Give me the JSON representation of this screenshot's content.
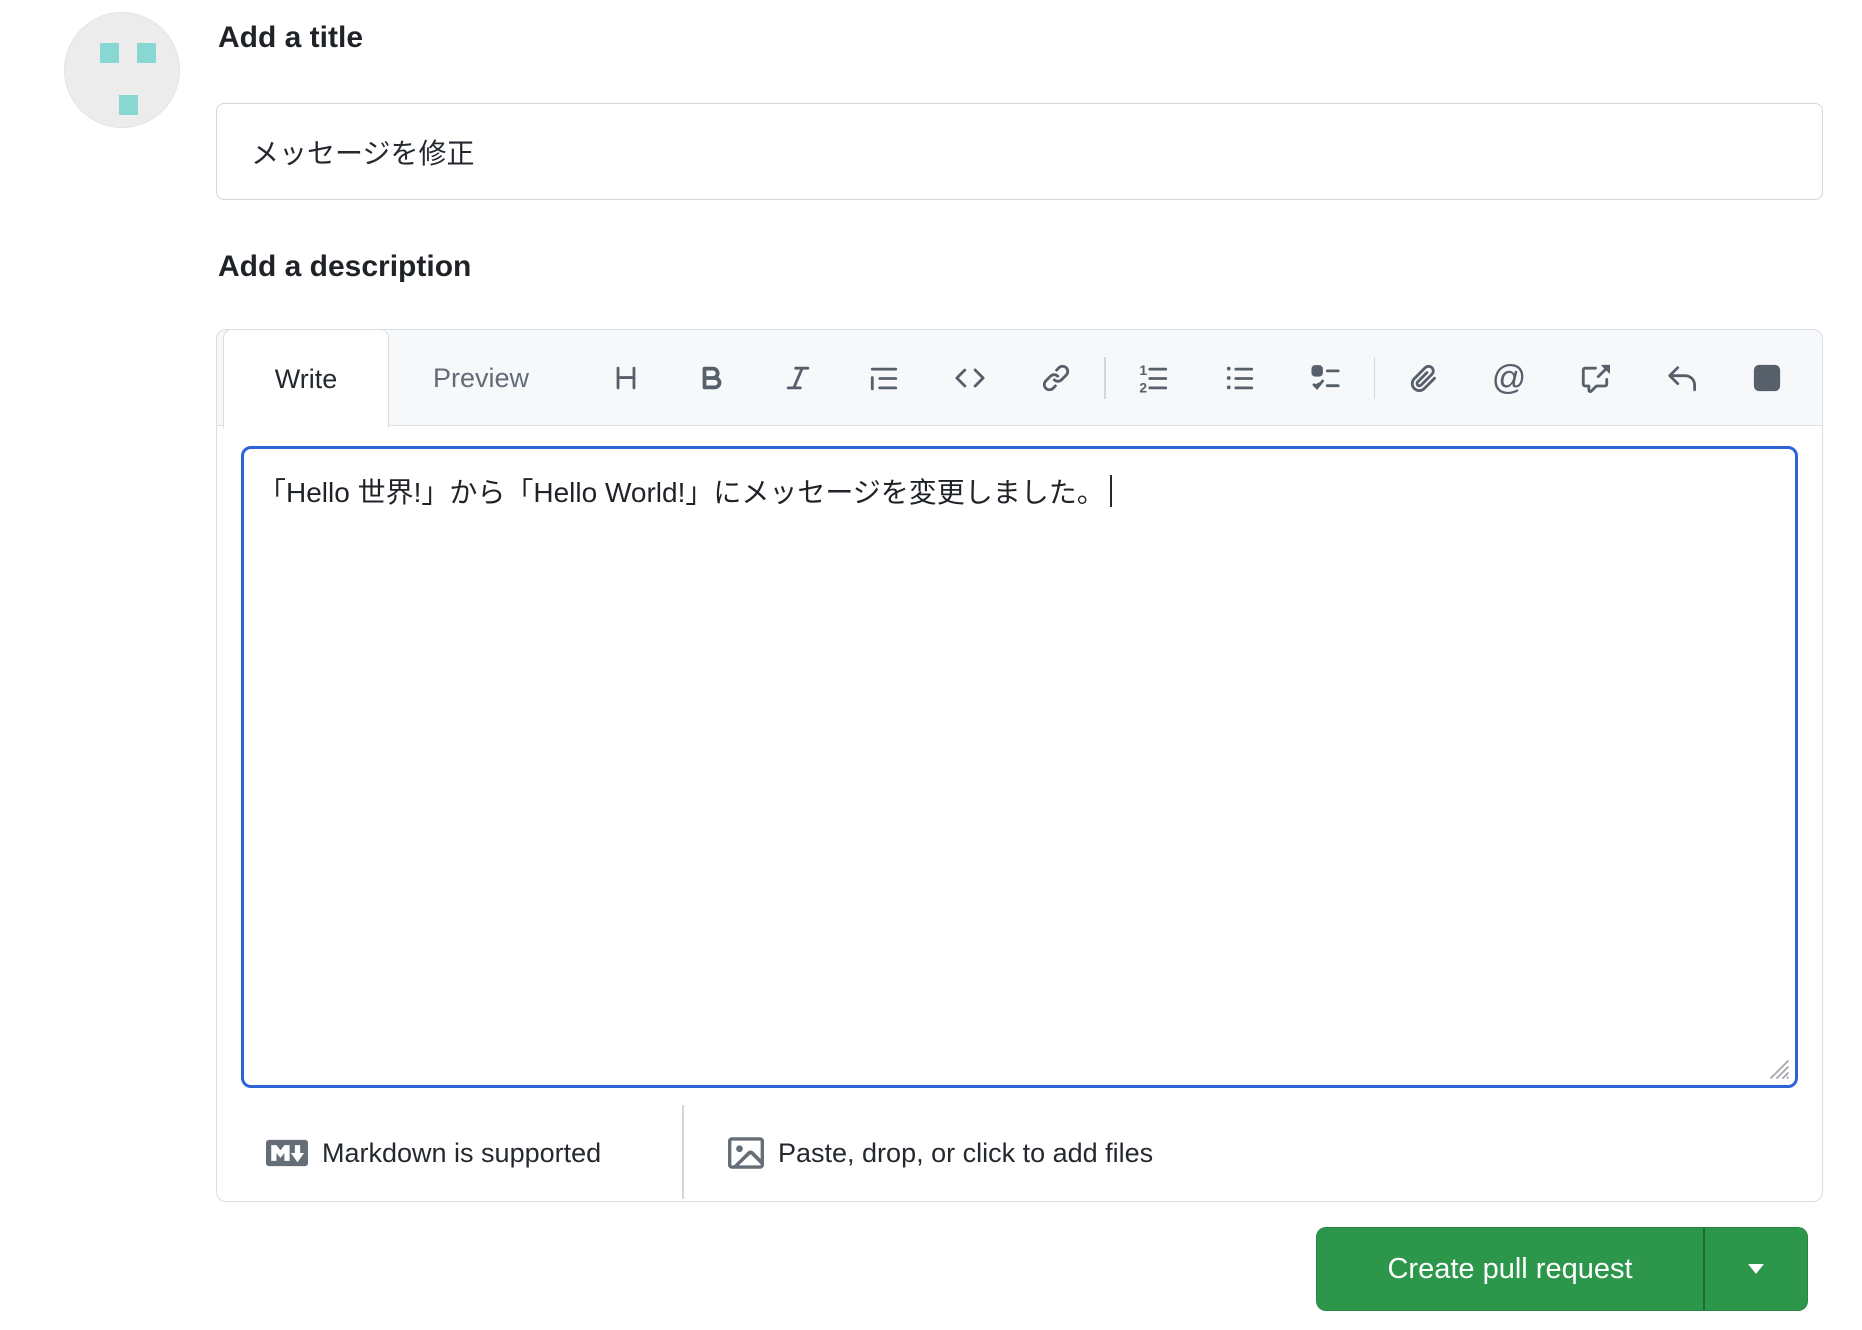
{
  "form": {
    "title_label": "Add a title",
    "title_value": "メッセージを修正",
    "description_label": "Add a description"
  },
  "editor": {
    "tabs": {
      "write": "Write",
      "preview": "Preview"
    },
    "toolbar_icons": [
      "heading-icon",
      "bold-icon",
      "italic-icon",
      "quote-icon",
      "code-icon",
      "link-icon",
      "ordered-list-icon",
      "unordered-list-icon",
      "tasklist-icon",
      "paperclip-icon",
      "mention-icon",
      "cross-reference-icon",
      "reply-icon",
      "slash-command-icon"
    ],
    "body_text": "「Hello 世界!」から「Hello World!」にメッセージを変更しました。",
    "footer": {
      "markdown_note": "Markdown is supported",
      "attach_note": "Paste, drop, or click to add files"
    }
  },
  "actions": {
    "create_pull_request": "Create pull request"
  },
  "colors": {
    "primary_button_green": "#2c974b",
    "focus_border_blue": "#2c63d6",
    "avatar_teal": "#89d7d2",
    "toolbar_icon_gray": "#57606a",
    "border_gray": "#d0d7de",
    "header_strip_gray": "#f6f8fa"
  }
}
